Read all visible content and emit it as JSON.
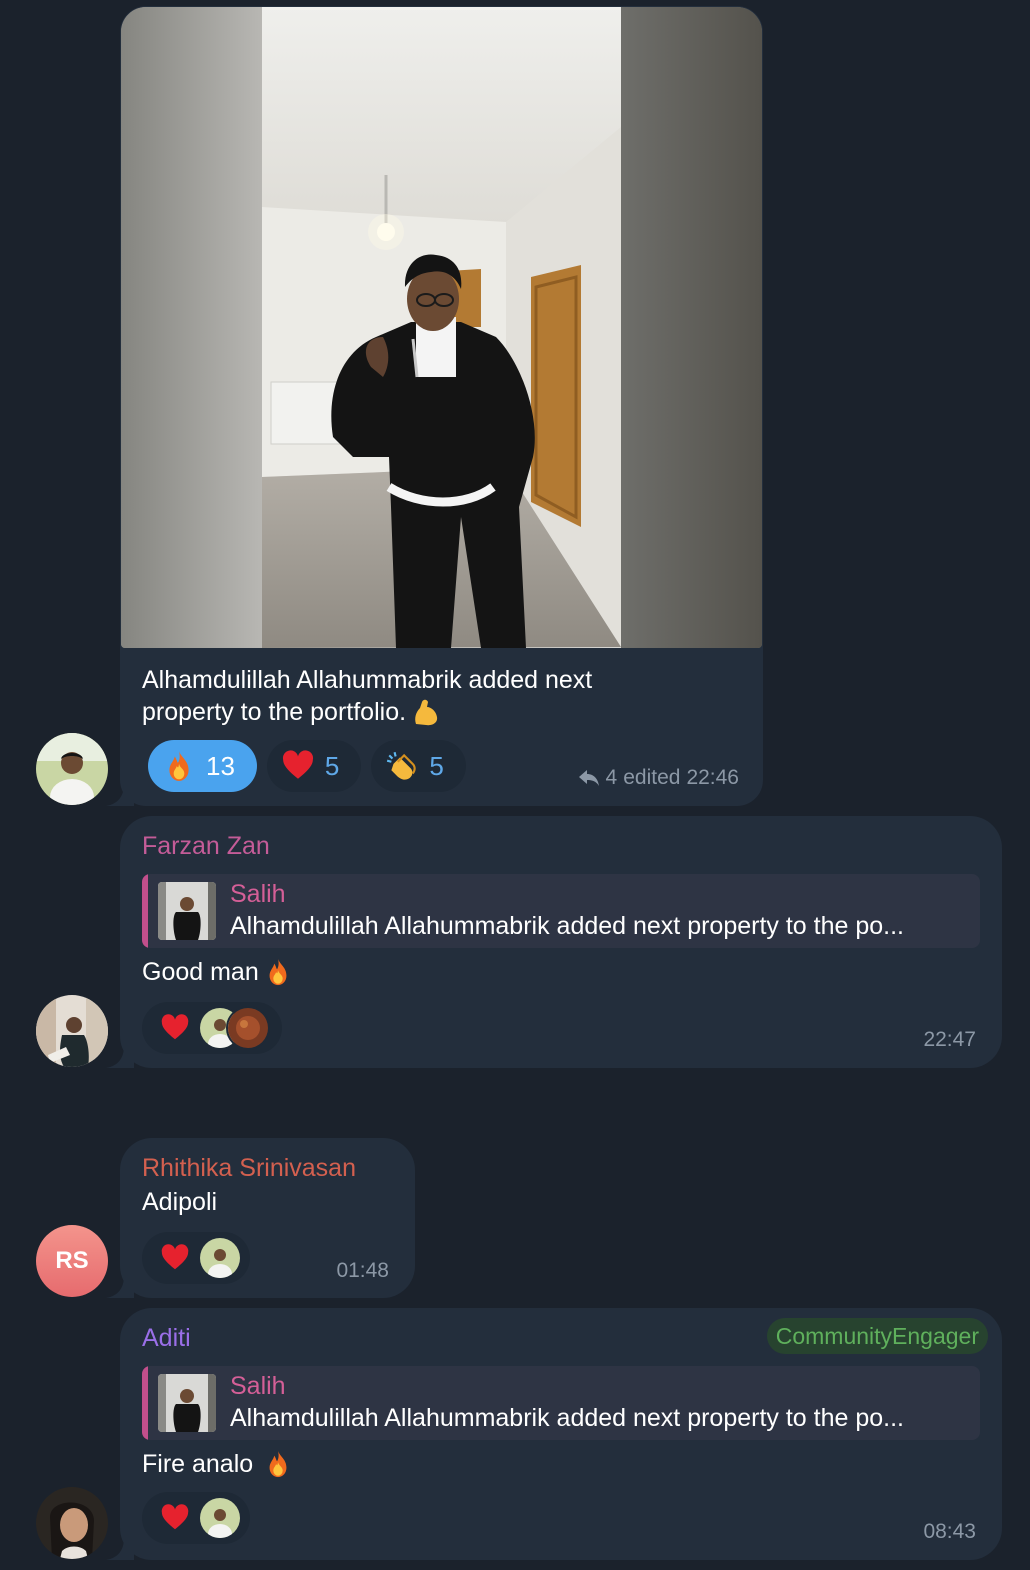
{
  "messages": {
    "m1": {
      "caption_line1": "Alhamdulillah Allahummabrik added next",
      "caption_line2": "property to the portfolio.",
      "caption_emoji": "flexed-biceps",
      "reactions": [
        {
          "emoji": "fire",
          "count": "13",
          "active": true
        },
        {
          "emoji": "heart",
          "count": "5",
          "active": false
        },
        {
          "emoji": "clapping-hands",
          "count": "5",
          "active": false
        }
      ],
      "replies_count": "4",
      "edited": "edited",
      "time": "22:46"
    },
    "m2": {
      "sender": "Farzan Zan",
      "sender_color": "#c45c98",
      "quote_name": "Salih",
      "quote_text": "Alhamdulillah Allahummabrik added next property to the po...",
      "text": "Good man",
      "text_emoji": "fire",
      "reaction_emoji": "heart",
      "time": "22:47"
    },
    "m3": {
      "sender": "Rhithika Srinivasan",
      "sender_color": "#d3604f",
      "text": "Adipoli",
      "avatar_initials": "RS",
      "reaction_emoji": "heart",
      "time": "01:48"
    },
    "m4": {
      "sender": "Aditi",
      "sender_color": "#9a6fe8",
      "badge": "CommunityEngager",
      "quote_name": "Salih",
      "quote_text": "Alhamdulillah Allahummabrik added next property to the po...",
      "text": "Fire analo",
      "text_emoji": "fire",
      "reaction_emoji": "heart",
      "time": "08:43"
    }
  },
  "colors": {
    "background": "#1b222c",
    "bubble": "#232e3c",
    "active_reaction": "#4aa3ee",
    "reaction_count": "#5fa8e8",
    "badge_text": "#5fb05c",
    "time": "#8c98a6"
  }
}
